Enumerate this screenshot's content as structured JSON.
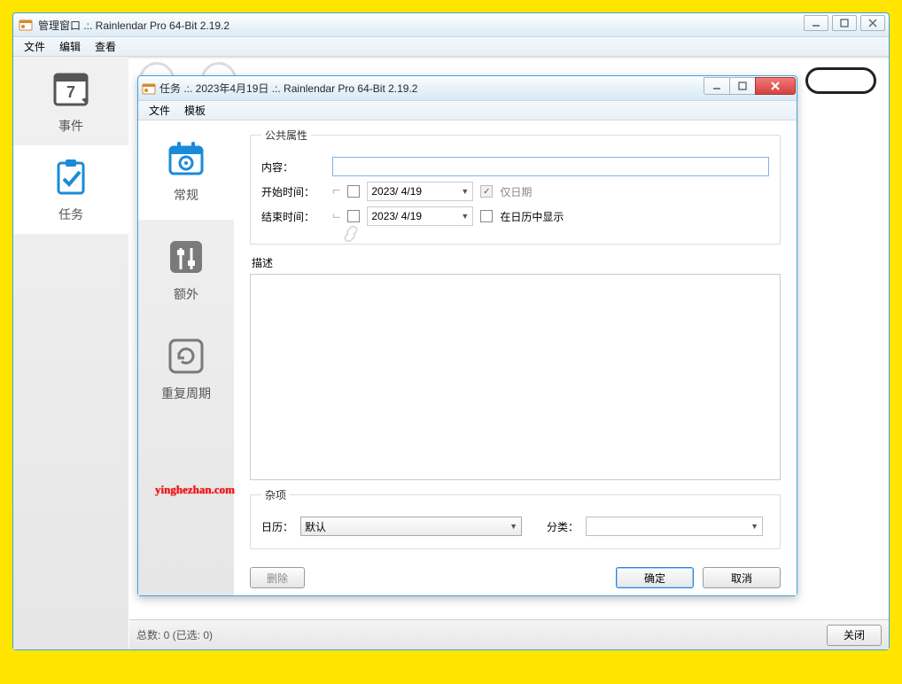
{
  "outer": {
    "title": "管理窗口 .:. Rainlendar Pro 64-Bit 2.19.2",
    "menu": {
      "file": "文件",
      "edit": "编辑",
      "view": "查看"
    },
    "tabs": {
      "events": "事件",
      "tasks": "任务"
    },
    "status": "总数: 0 (已选: 0)",
    "close_btn": "关闭"
  },
  "task": {
    "title": "任务 .:. 2023年4月19日 .:. Rainlendar Pro 64-Bit 2.19.2",
    "menu": {
      "file": "文件",
      "template": "模板"
    },
    "sidebar": {
      "general": "常规",
      "extra": "额外",
      "recur": "重复周期"
    },
    "group_public": "公共属性",
    "label_content": "内容：",
    "content_value": "",
    "label_start": "开始时间：",
    "label_end": "结束时间：",
    "date_value": "2023/ 4/19",
    "chk_dateonly": "仅日期",
    "chk_showcal": "在日历中显示",
    "label_desc": "描述",
    "group_misc": "杂项",
    "label_calendar": "日历：",
    "calendar_value": "默认",
    "label_category": "分类：",
    "category_value": "",
    "btn_delete": "删除",
    "btn_ok": "确定",
    "btn_cancel": "取消"
  },
  "watermark": "yinghezhan.com"
}
